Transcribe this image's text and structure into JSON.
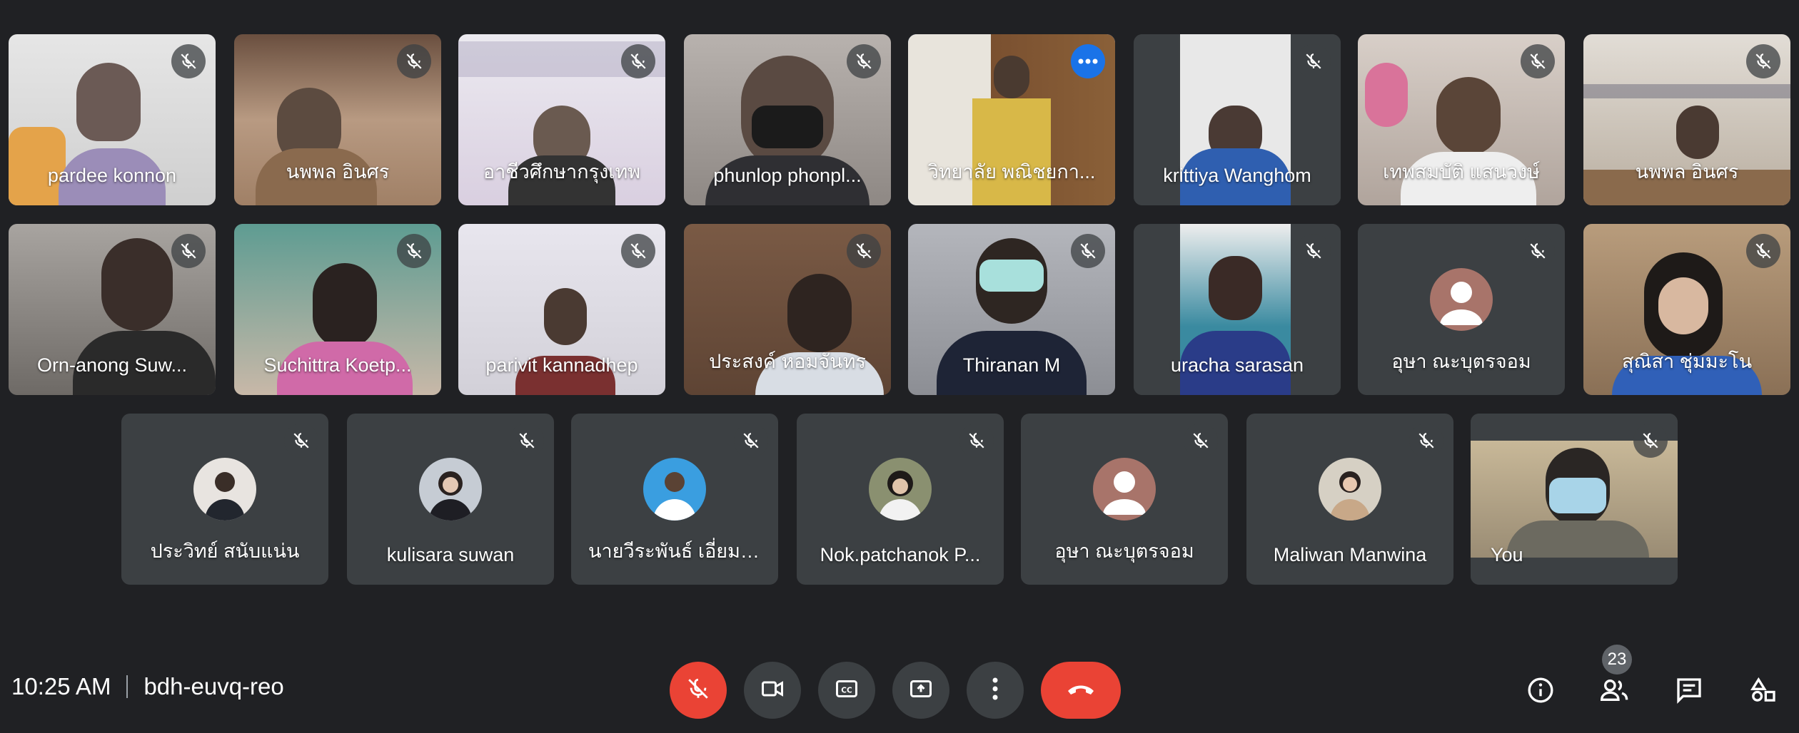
{
  "participants": [
    {
      "name": "pardee konnon",
      "muted": true,
      "bg": "#d8d8d8"
    },
    {
      "name": "นพพล อินศร",
      "muted": true,
      "bg": "#b5a496"
    },
    {
      "name": "อาชีวศึกษากรุงเทพ",
      "muted": true,
      "bg": "#dcd6e0"
    },
    {
      "name": "phunlop phonpl...",
      "muted": true,
      "bg": "#9f9a98"
    },
    {
      "name": "วิทยาลัย พณิชยกา...",
      "muted": false,
      "bg": "#c4a163"
    },
    {
      "name": "krittiya Wanghom",
      "muted": true,
      "bg": "#5f7da3"
    },
    {
      "name": "เทพสมบัติ แสนวงษ์",
      "muted": true,
      "bg": "#c9c1bd"
    },
    {
      "name": "นพพล อินศร",
      "muted": true,
      "bg": "#b8b3ac"
    },
    {
      "name": "Orn-anong Suw...",
      "muted": true,
      "bg": "#8a8480"
    },
    {
      "name": "Suchittra Koetp...",
      "muted": true,
      "bg": "#5e8c86"
    },
    {
      "name": "parivit kannadhep",
      "muted": true,
      "bg": "#d9d9dc"
    },
    {
      "name": "ประสงค์ หอมจันทร",
      "muted": true,
      "bg": "#7a5a45"
    },
    {
      "name": "Thiranan M",
      "muted": true,
      "bg": "#9d9fa6"
    },
    {
      "name": "uracha sarasan",
      "muted": true,
      "bg": "#4b5c86"
    },
    {
      "name": "อุษา ณะบุตรจอม",
      "muted": true,
      "bg": "#3c4043"
    },
    {
      "name": "สุณิสา ชุ่มมะโน",
      "muted": true,
      "bg": "#a68c6d"
    },
    {
      "name": "ประวิทย์ สนับแน่น",
      "muted": true,
      "bg": "#3c4043"
    },
    {
      "name": "kulisara suwan",
      "muted": true,
      "bg": "#3c4043"
    },
    {
      "name": "นายวีระพันธ์ เอี่ยมส...",
      "muted": true,
      "bg": "#3c4043"
    },
    {
      "name": "Nok.patchanok P...",
      "muted": true,
      "bg": "#3c4043"
    },
    {
      "name": "อุษา ณะบุตรจอม",
      "muted": true,
      "bg": "#3c4043"
    },
    {
      "name": "Maliwan Manwina",
      "muted": true,
      "bg": "#3c4043"
    },
    {
      "name": "You",
      "muted": true,
      "bg": "#b8aa8e"
    }
  ],
  "meeting": {
    "time": "10:25 AM",
    "code": "bdh-euvq-reo"
  },
  "people_count": "23",
  "colors": {
    "accent": "#8ab4f8",
    "danger": "#ea4335",
    "surface": "#3c4043",
    "background": "#202124"
  },
  "icons": [
    "mic-off-icon",
    "camera-icon",
    "captions-icon",
    "present-icon",
    "more-vert-icon",
    "call-end-icon",
    "info-icon",
    "people-icon",
    "chat-icon",
    "activities-icon"
  ]
}
